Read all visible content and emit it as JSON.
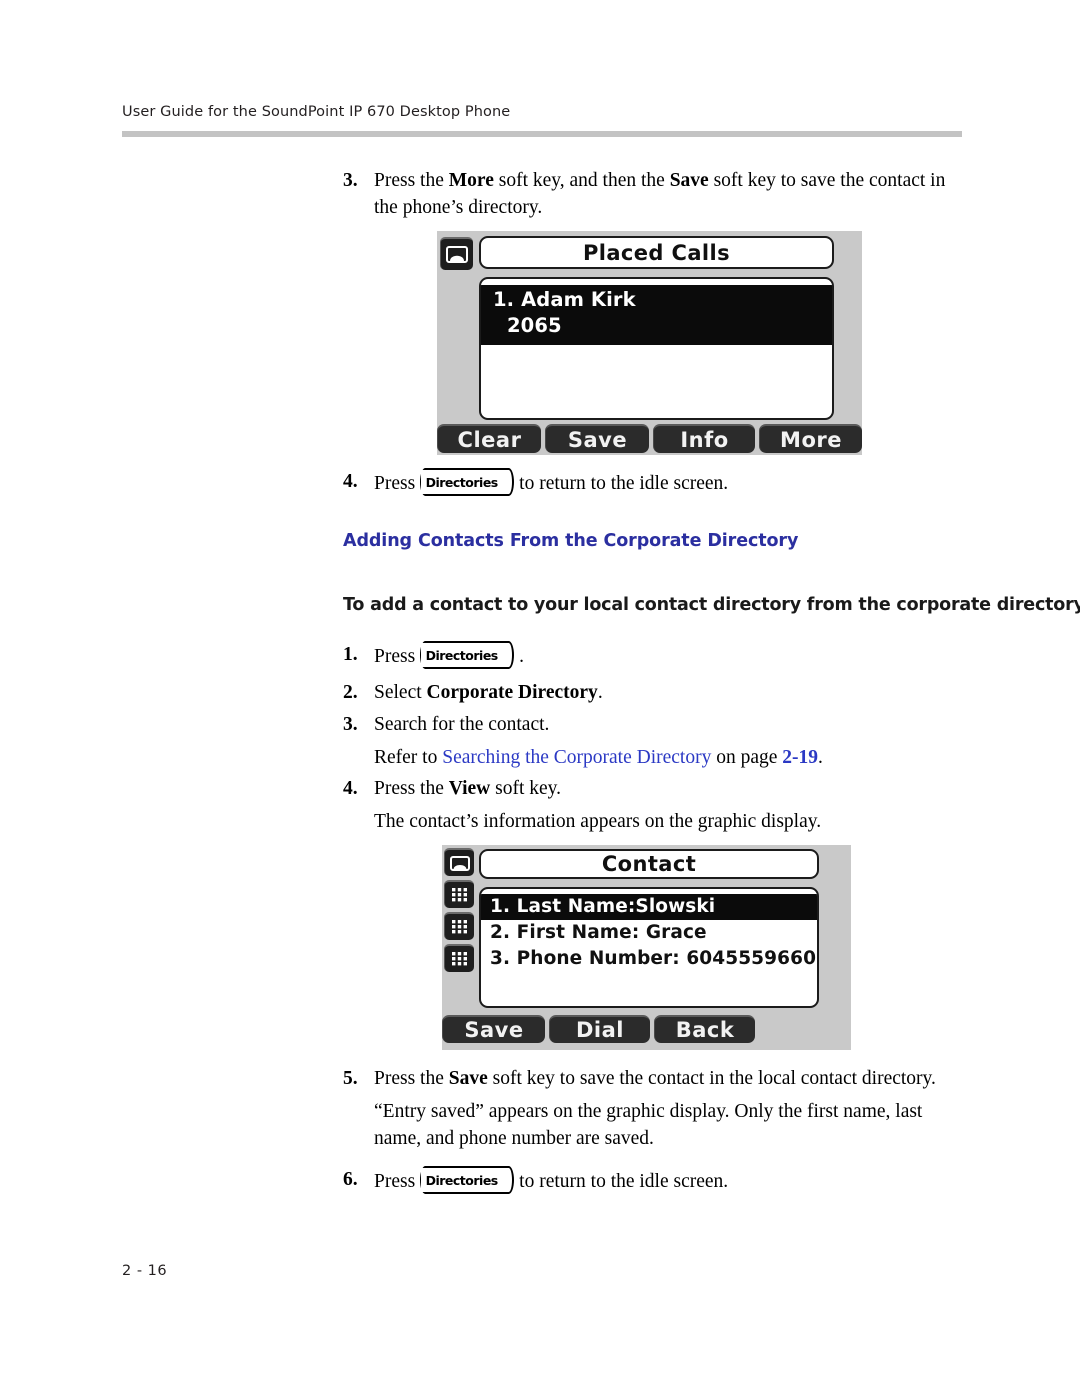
{
  "page": {
    "header": "User Guide for the SoundPoint IP 670 Desktop Phone",
    "footer": "2 - 16"
  },
  "step3": {
    "num": "3.",
    "text_1": "Press the ",
    "bold_1": "More",
    "text_2": " soft key, and then the ",
    "bold_2": "Save",
    "text_3": " soft key to save the contact in the phone’s directory."
  },
  "placed_calls_screen": {
    "phone_icon": "handset-icon",
    "title": "Placed Calls",
    "rows": [
      {
        "label": "1. Adam Kirk",
        "selected": true
      },
      {
        "label": "2065",
        "selected": true
      }
    ],
    "softkeys": [
      "Clear",
      "Save",
      "Info",
      "More"
    ]
  },
  "step4_top": {
    "num": "4.",
    "text_1": "Press",
    "key_label": "Directories",
    "text_2": "to return to the idle screen."
  },
  "section_heading": "Adding Contacts From the Corporate Directory",
  "task_heading": "To add a contact to your local contact directory from the corporate directory:",
  "step1": {
    "num": "1.",
    "text_1": "Press",
    "key_label": "Directories",
    "text_2": "."
  },
  "step2": {
    "num": "2.",
    "text_1": "Select ",
    "bold_1": "Corporate Directory",
    "text_2": "."
  },
  "step3b": {
    "num": "3.",
    "text_1": "Search for the contact."
  },
  "refer_line": {
    "text_1": "Refer to ",
    "link": "Searching the Corporate Directory",
    "text_2": " on page ",
    "page": "2-19",
    "text_3": "."
  },
  "step4": {
    "num": "4.",
    "text_1": "Press the ",
    "bold_1": "View",
    "text_2": " soft key."
  },
  "step4_result": "The contact’s information appears on the graphic display.",
  "contact_screen": {
    "bezel_icons": [
      "handset-icon",
      "keypad-icon",
      "keypad-icon",
      "keypad-icon"
    ],
    "title": "Contact",
    "rows": [
      {
        "label": "1. Last Name:Slowski",
        "selected": true
      },
      {
        "label": "2. First Name: Grace",
        "selected": false
      },
      {
        "label": "3. Phone Number: 6045559660",
        "selected": false
      }
    ],
    "softkeys": [
      "Save",
      "Dial",
      "Back"
    ]
  },
  "step5": {
    "num": "5.",
    "text_1": "Press the ",
    "bold_1": "Save",
    "text_2": " soft key to save the contact in the local contact directory."
  },
  "step5_result": "“Entry saved” appears on the graphic display. Only the first name, last name, and phone number are saved.",
  "step6": {
    "num": "6.",
    "text_1": "Press",
    "key_label": "Directories",
    "text_2": "to return to the idle screen."
  }
}
